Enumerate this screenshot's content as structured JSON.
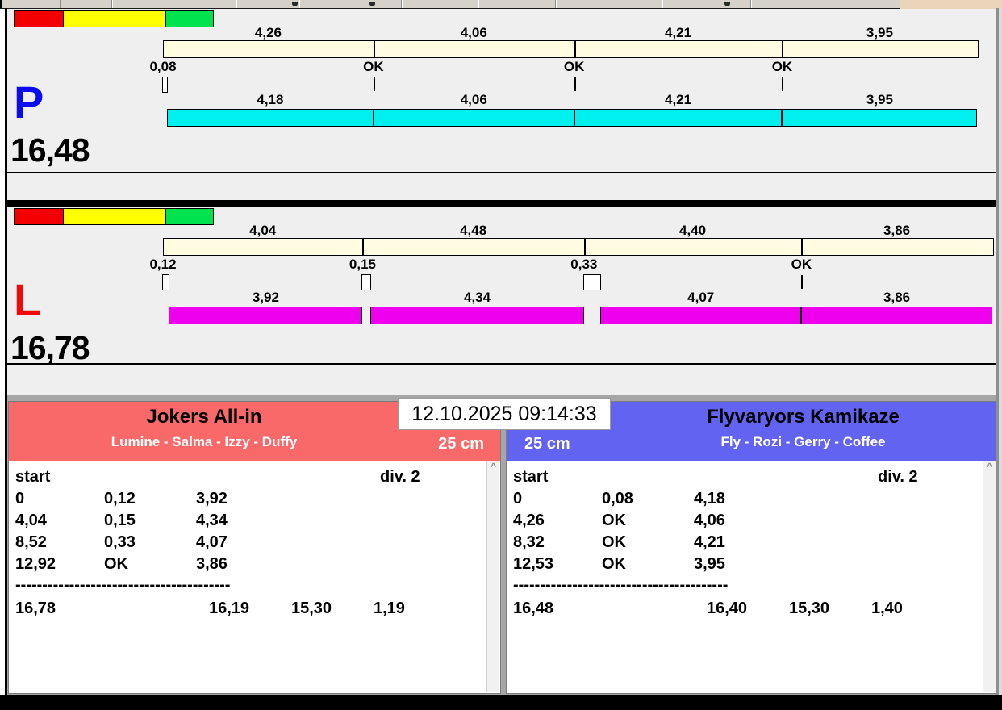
{
  "datetime": "12.10.2025 09:14:33",
  "traffic_light": [
    "#f40000",
    "#ffff00",
    "#ffff00",
    "#00e34f"
  ],
  "colors": {
    "split_bar": "#fffce1",
    "lane_p_run": "#00f0f0",
    "lane_l_run": "#ee00ee",
    "lane_p_letter": "#0b0bf0",
    "lane_l_letter": "#f00b0b",
    "panel_left_accent": "#f96969",
    "panel_right_accent": "#6363f2"
  },
  "icons": {
    "scroll_up": "^"
  },
  "lanes": [
    {
      "letter": "P",
      "total": "16,48",
      "top_segments": [
        "4,26",
        "4,06",
        "4,21",
        "3,95"
      ],
      "passes": [
        "0,08",
        "OK",
        "OK",
        "OK"
      ],
      "bottom_segments": [
        "4,18",
        "4,06",
        "4,21",
        "3,95"
      ],
      "run_color": "#00f0f0"
    },
    {
      "letter": "L",
      "total": "16,78",
      "top_segments": [
        "4,04",
        "4,48",
        "4,40",
        "3,86"
      ],
      "passes": [
        "0,12",
        "0,15",
        "0,33",
        "OK"
      ],
      "bottom_segments": [
        "3,92",
        "4,34",
        "4,07",
        "3,86"
      ],
      "run_color": "#ee00ee"
    }
  ],
  "panels": [
    {
      "team": "Jokers All-in",
      "dogs": "Lumine - Salma - Izzy - Duffy",
      "height": "25 cm",
      "table": {
        "start_label": "start",
        "division": "div.  2",
        "rows": [
          [
            "0",
            "0,12",
            "3,92"
          ],
          [
            "4,04",
            "0,15",
            "4,34"
          ],
          [
            "8,52",
            "0,33",
            "4,07"
          ],
          [
            "12,92",
            "OK",
            "3,86"
          ]
        ],
        "separator": "----------------------------------------",
        "totals": [
          "16,78",
          "16,19",
          "15,30",
          "1,19"
        ]
      }
    },
    {
      "team": "Flyvaryors Kamikaze",
      "dogs": "Fly - Rozi - Gerry - Coffee",
      "height": "25 cm",
      "table": {
        "start_label": "start",
        "division": "div.  2",
        "rows": [
          [
            "0",
            "0,08",
            "4,18"
          ],
          [
            "4,26",
            "OK",
            "4,06"
          ],
          [
            "8,32",
            "OK",
            "4,21"
          ],
          [
            "12,53",
            "OK",
            "3,95"
          ]
        ],
        "separator": "----------------------------------------",
        "totals": [
          "16,48",
          "16,40",
          "15,30",
          "1,40"
        ]
      }
    }
  ]
}
